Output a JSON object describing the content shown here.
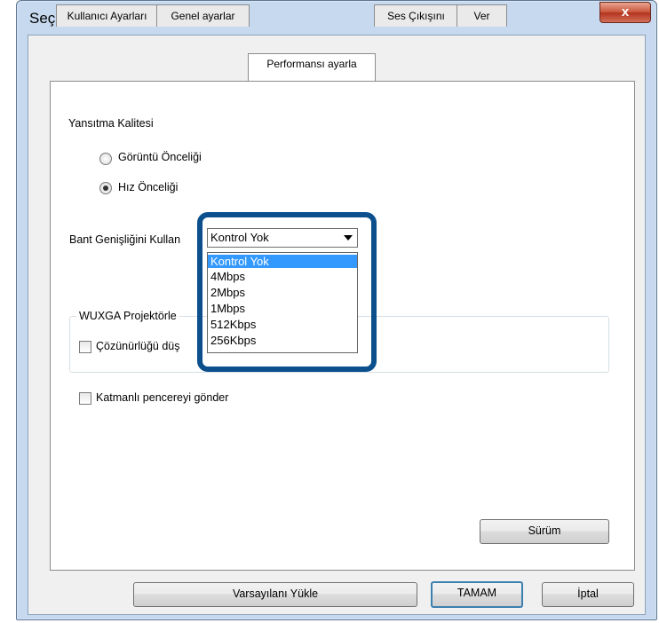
{
  "window": {
    "title": "Seçenekleri ayarla",
    "close_label": "x"
  },
  "tabs": [
    {
      "label": "Kullanıcı Ayarları"
    },
    {
      "label": "Genel ayarlar"
    },
    {
      "label": "Performansı ayarla"
    },
    {
      "label": "Ses Çıkışını"
    },
    {
      "label": "Ver"
    }
  ],
  "performance": {
    "quality_heading": "Yansıtma Kalitesi",
    "radio_image": "Görüntü Önceliği",
    "radio_speed": "Hız Önceliği",
    "selected_radio": "Hız Önceliği",
    "bandwidth_label": "Bant Genişliğini Kullan",
    "bandwidth_value": "Kontrol Yok",
    "bandwidth_options": [
      "Kontrol Yok",
      "4Mbps",
      "2Mbps",
      "1Mbps",
      "512Kbps",
      "256Kbps"
    ],
    "group_title": "WUXGA Projektörle",
    "reduce_resolution": "Çözünürlüğü düş",
    "layered_window": "Katmanlı pencereyi gönder"
  },
  "buttons": {
    "version": "Sürüm",
    "load_defaults": "Varsayılanı Yükle",
    "ok": "TAMAM",
    "cancel": "İptal"
  },
  "colors": {
    "highlight_border": "#0b4f8c",
    "selection": "#3399ff"
  }
}
